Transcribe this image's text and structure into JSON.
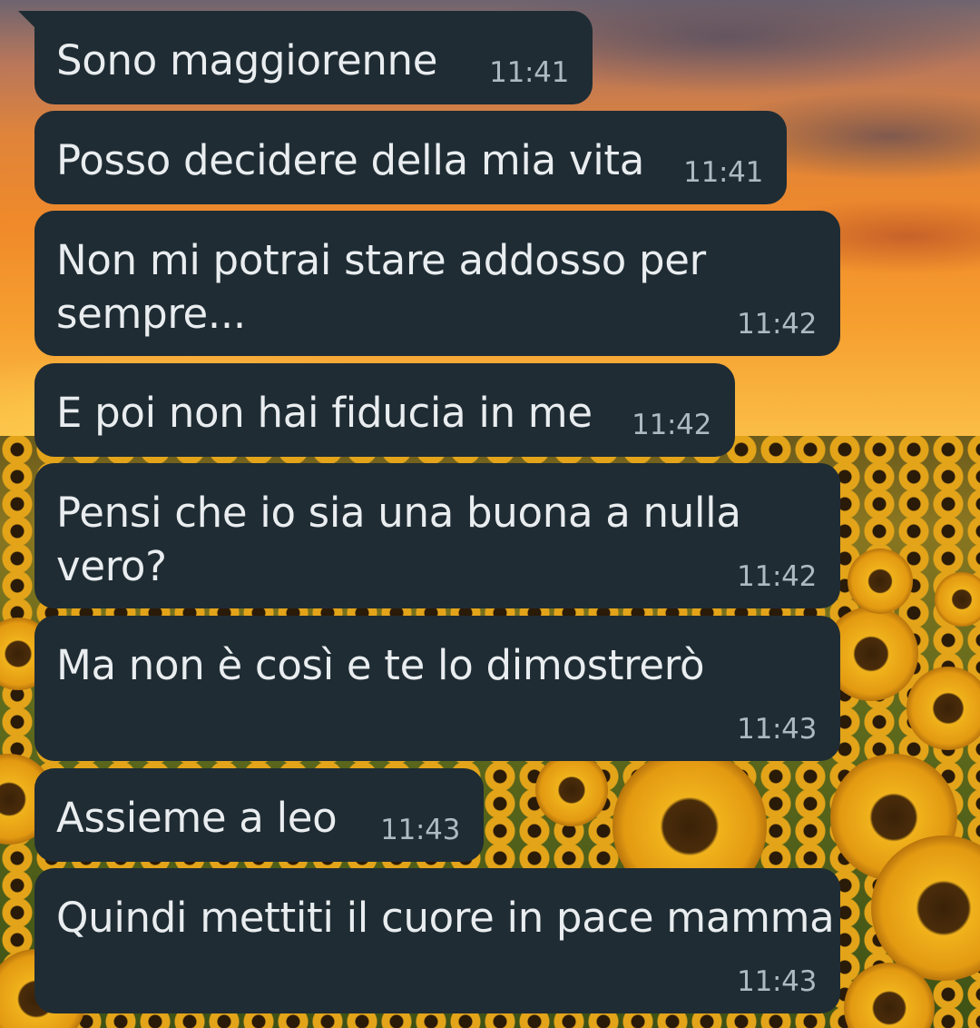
{
  "chat": {
    "messages": [
      {
        "text": "Sono maggiorenne",
        "time": "11:41"
      },
      {
        "text": "Posso decidere della mia vita",
        "time": "11:41"
      },
      {
        "text": "Non mi potrai stare addosso per\nsempre...",
        "time": "11:42"
      },
      {
        "text": "E poi non hai fiducia in me",
        "time": "11:42"
      },
      {
        "text": "Pensi che io sia una buona a nulla\nvero?",
        "time": "11:42"
      },
      {
        "text": "Ma non è così e te lo dimostrerò",
        "time": "11:43"
      },
      {
        "text": "Assieme a leo",
        "time": "11:43"
      },
      {
        "text": "Quindi mettiti il cuore in pace mamma",
        "time": "11:43"
      }
    ]
  },
  "colors": {
    "bubble": "#1f2c34",
    "message_text": "#e9edef",
    "timestamp": "#aebac1"
  },
  "wallpaper": {
    "description_icon": "sunflower-field-sunset-wallpaper"
  }
}
